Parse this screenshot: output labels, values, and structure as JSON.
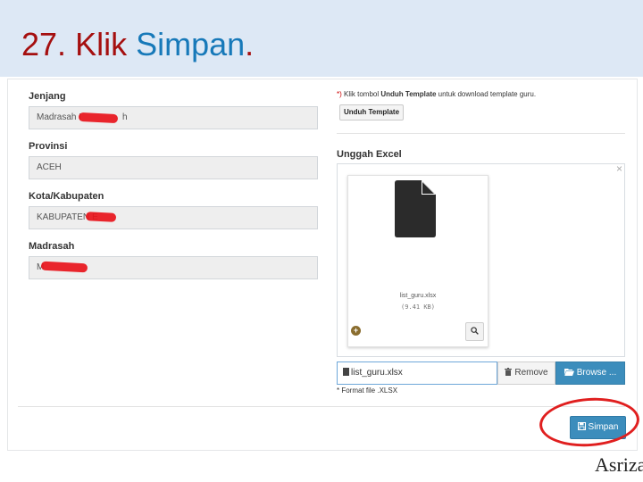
{
  "slide": {
    "title_number": "27.",
    "title_word_red": "Klik",
    "title_word_blue": "Simpan",
    "title_period": ".",
    "author": "Asrizal"
  },
  "colors": {
    "title_red": "#a50f0f",
    "title_blue": "#1779b9",
    "header_bg": "#dde8f5",
    "primary_button": "#3c8dbc",
    "highlight_circle": "#e01f1f"
  },
  "form": {
    "fields": [
      {
        "label": "Jenjang",
        "value": "Madrasah Ibtidaiyah",
        "visible_value": "Madrasah I",
        "visible_tail": "h"
      },
      {
        "label": "Provinsi",
        "value": "ACEH"
      },
      {
        "label": "Kota/Kabupaten",
        "value": "KABUPATEN",
        "visible_tail": "E"
      },
      {
        "label": "Madrasah",
        "visible_value": "M"
      }
    ]
  },
  "template": {
    "hint_star": "*)",
    "hint_prefix": " Klik tombol ",
    "hint_bold": "Unduh Template",
    "hint_suffix": " untuk download template guru.",
    "button_label": "Unduh Template"
  },
  "upload": {
    "label": "Unggah Excel",
    "close_glyph": "×",
    "file_name": "list_guru.xlsx",
    "file_size": "(9.41 KB)",
    "caption_value": "list_guru.xlsx",
    "remove_label": "Remove",
    "browse_label": "Browse ...",
    "format_note": "* Format file .XLSX"
  },
  "actions": {
    "save_label": "Simpan"
  },
  "icons": {
    "file_preview": "file-icon",
    "add": "plus-circle-icon",
    "zoom": "zoom-in-icon",
    "trash": "trash-icon",
    "folder": "folder-open-icon",
    "save": "floppy-disk-icon"
  }
}
